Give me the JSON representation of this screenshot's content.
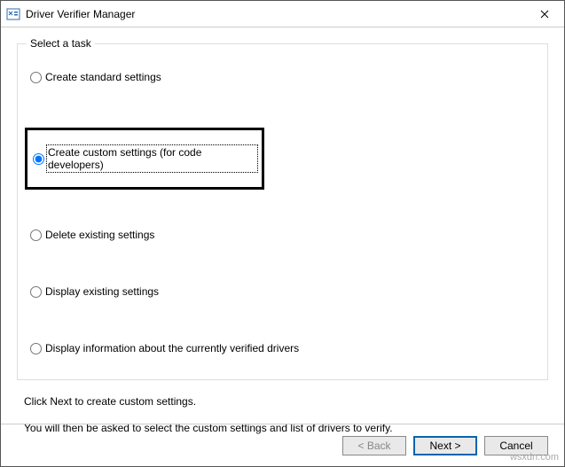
{
  "window": {
    "title": "Driver Verifier Manager"
  },
  "group": {
    "legend": "Select a task"
  },
  "options": {
    "standard": "Create standard settings",
    "custom": "Create custom settings (for code developers)",
    "delete": "Delete existing settings",
    "display": "Display existing settings",
    "info": "Display information about the currently verified drivers"
  },
  "instruction1": "Click Next to create custom settings.",
  "instruction2": "You will then be asked to select the custom settings and list of drivers to verify.",
  "buttons": {
    "back": "< Back",
    "next": "Next >",
    "cancel": "Cancel"
  },
  "watermark": "wsxdn.com"
}
